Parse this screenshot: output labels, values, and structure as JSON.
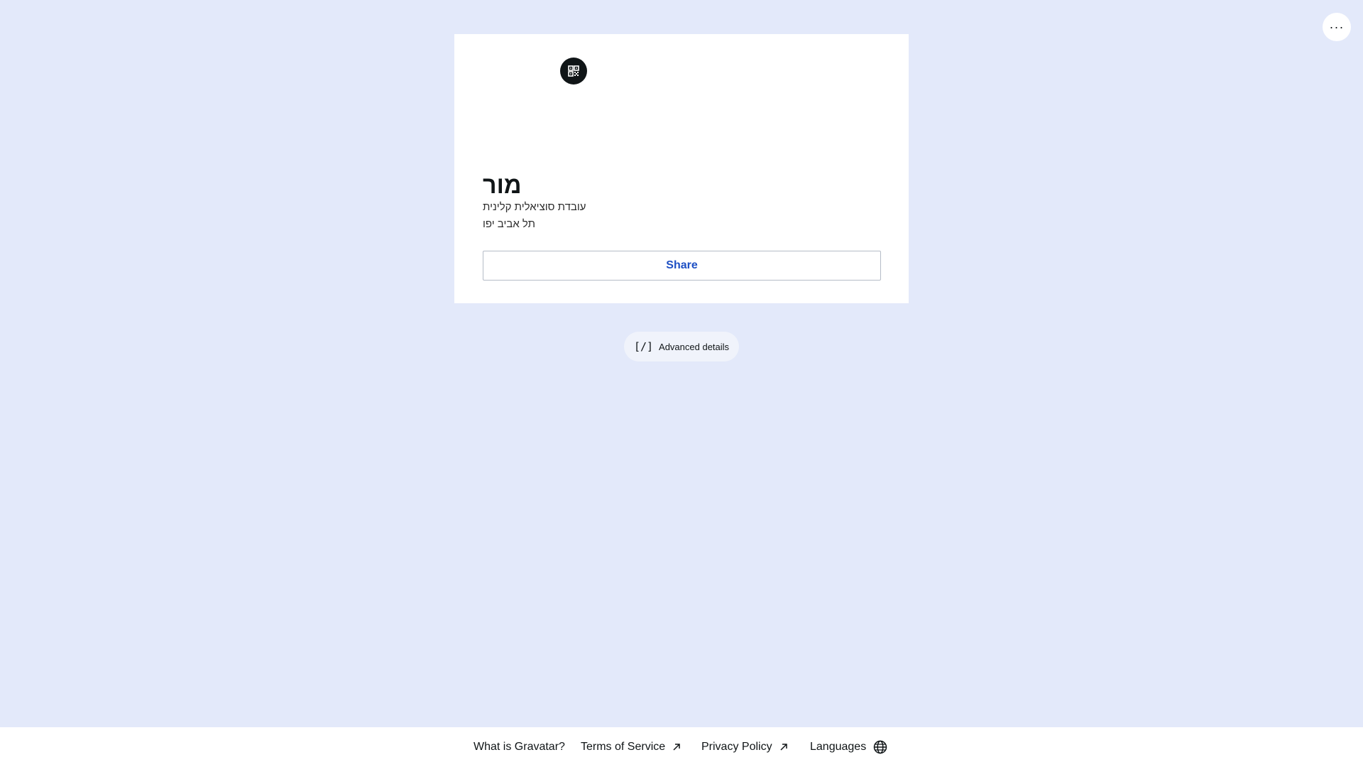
{
  "header": {
    "menu_icon": "ellipsis-icon",
    "menu_label": "···"
  },
  "profile": {
    "qr_icon": "qr-code-icon",
    "name": "מור",
    "job_title": "עובדת סוציאלית קלינית",
    "location": "תל אביב יפו",
    "share_label": "Share"
  },
  "advanced": {
    "icon_text": "[/]",
    "label": "Advanced details"
  },
  "footer": {
    "links": [
      {
        "label": "What is Gravatar?",
        "icon": ""
      },
      {
        "label": "Terms of Service",
        "icon": "external-arrow-icon"
      },
      {
        "label": "Privacy Policy",
        "icon": "external-arrow-icon"
      },
      {
        "label": "Languages",
        "icon": "globe-icon"
      }
    ]
  },
  "colors": {
    "background": "#e3e9fa",
    "accent": "#1d4fc4",
    "dark": "#101517"
  }
}
